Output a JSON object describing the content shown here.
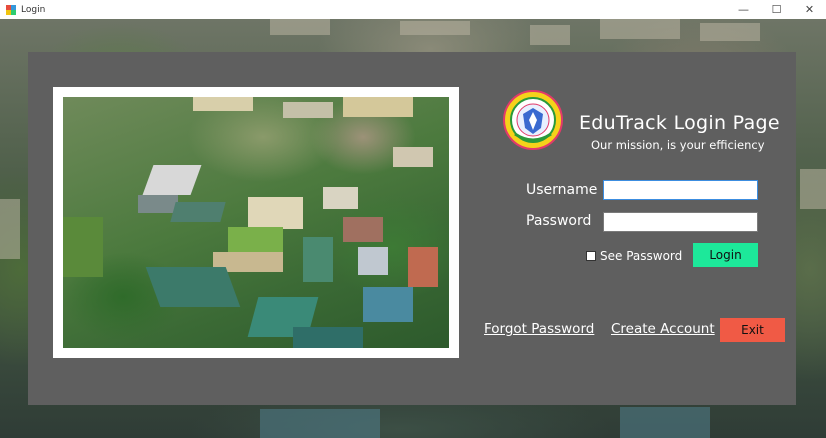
{
  "window": {
    "title": "Login",
    "icon": "app-icon",
    "controls": {
      "minimize": "—",
      "maximize": "☐",
      "close": "✕"
    }
  },
  "branding": {
    "app_title": "EduTrack Login Page",
    "subtitle": "Our mission, is your efficiency",
    "logo_icon": "school-seal-icon"
  },
  "form": {
    "username_label": "Username",
    "username_value": "",
    "password_label": "Password",
    "password_value": "",
    "see_password_label": "See Password",
    "see_password_checked": false,
    "login_label": "Login"
  },
  "links": {
    "forgot_password": "Forgot Password",
    "create_account": "Create Account"
  },
  "exit_label": "Exit",
  "colors": {
    "panel": "#5f5f5f",
    "login_button": "#1de89a",
    "exit_button": "#f05a45",
    "text": "#ffffff"
  }
}
